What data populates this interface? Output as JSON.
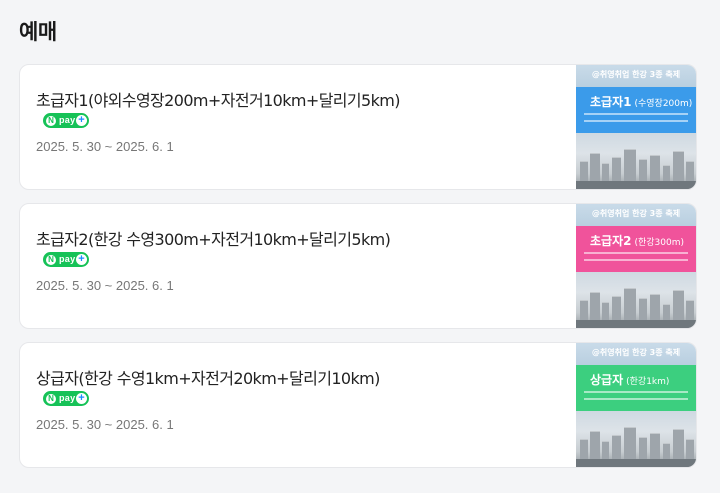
{
  "section": {
    "title": "예매"
  },
  "payment_badge": {
    "label": "pay",
    "n_mark": "N",
    "plus": "+"
  },
  "cards": [
    {
      "title": "초급자1(야외수영장200m+자전거10km+달리기5km)",
      "date": "2025. 5. 30 ~ 2025. 6. 1",
      "poster": {
        "header": "@취영취업 한강 3종 축제",
        "level": "초급자1",
        "sub": "(수영장200m)",
        "color": "#3b9bea"
      }
    },
    {
      "title": "초급자2(한강 수영300m+자전거10km+달리기5km)",
      "date": "2025. 5. 30 ~ 2025. 6. 1",
      "poster": {
        "header": "@취영취업 한강 3종 축제",
        "level": "초급자2",
        "sub": "(한강300m)",
        "color": "#f0539b"
      }
    },
    {
      "title": "상급자(한강 수영1km+자전거20km+달리기10km)",
      "date": "2025. 5. 30 ~ 2025. 6. 1",
      "poster": {
        "header": "@취영취업 한강 3종 축제",
        "level": "상급자",
        "sub": "(한강1km)",
        "color": "#3ccf7f"
      }
    }
  ]
}
